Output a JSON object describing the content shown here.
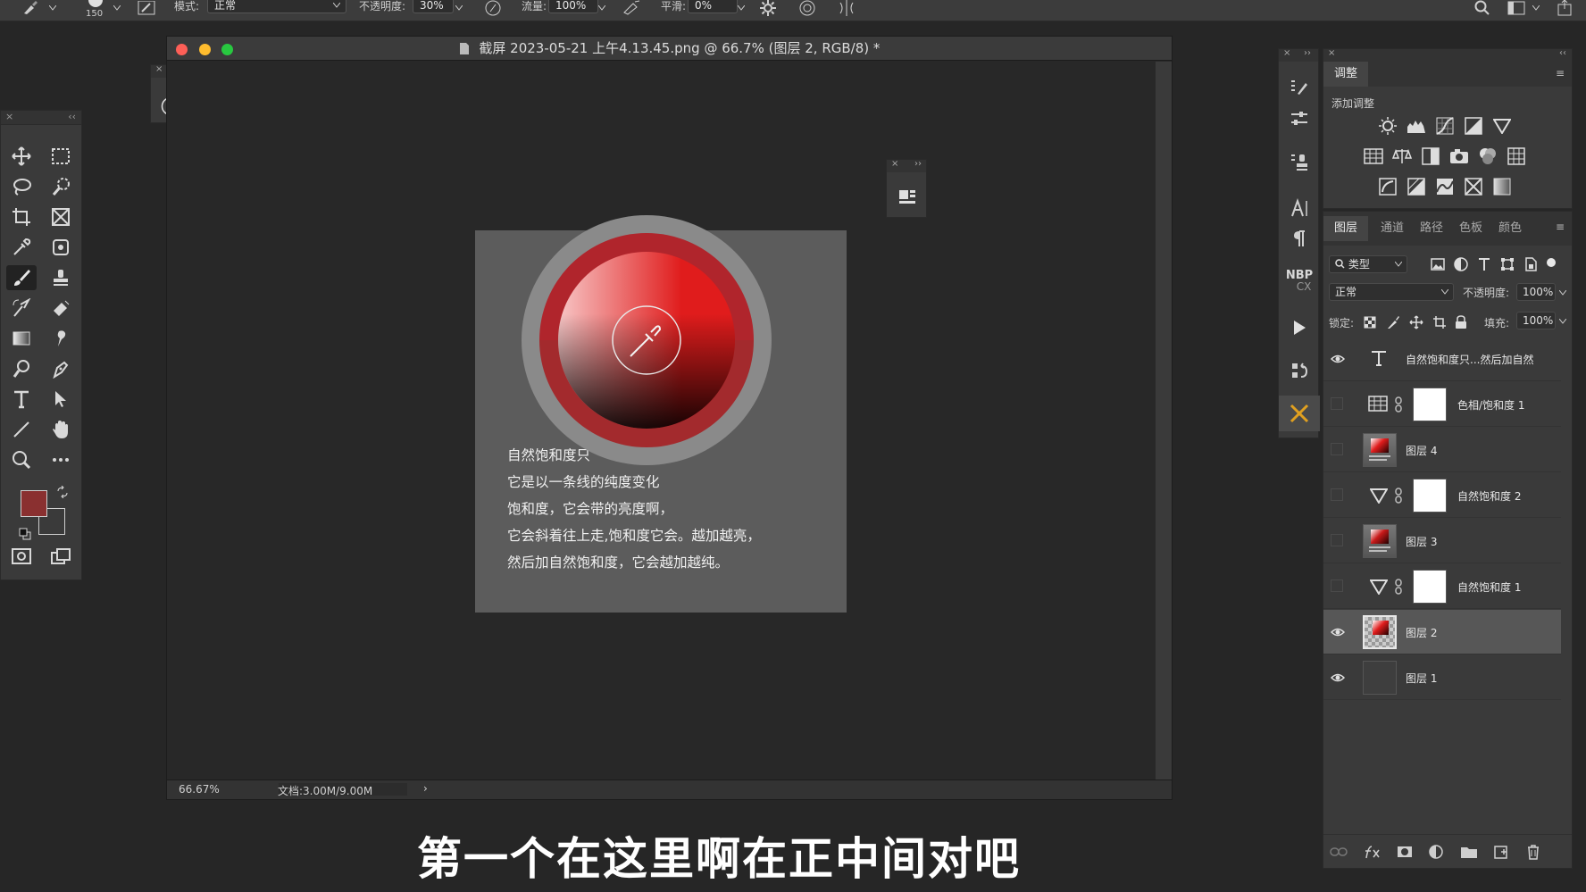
{
  "options_bar": {
    "brush_size": "150",
    "mode_label": "模式:",
    "mode_value": "正常",
    "opacity_label": "不透明度:",
    "opacity_value": "30%",
    "flow_label": "流量:",
    "flow_value": "100%",
    "smoothing_label": "平滑:",
    "smoothing_value": "0%"
  },
  "document": {
    "title": "截屏 2023-05-21 上午4.13.45.png @ 66.7% (图层 2, RGB/8) *",
    "zoom": "66.67%",
    "doc_size": "文档:3.00M/9.00M",
    "status_arrow": "›"
  },
  "canvas_text": [
    "自然饱和度只",
    "它是以一条线的纯度变化",
    "饱和度，它会带的亮度啊，",
    "它会斜着往上走,饱和度它会。越加越亮，",
    "然后加自然饱和度，它会越加越纯。"
  ],
  "colors": {
    "foreground": "#8a3030",
    "background": "#3a3a3a",
    "accent": "#d03030"
  },
  "adjustments": {
    "tab": "调整",
    "add_label": "添加调整"
  },
  "layers_panel": {
    "tabs": [
      "图层",
      "通道",
      "路径",
      "色板",
      "颜色"
    ],
    "filter_label": "类型",
    "blend_mode": "正常",
    "opacity_label": "不透明度:",
    "opacity_value": "100%",
    "lock_label": "锁定:",
    "fill_label": "填充:",
    "fill_value": "100%",
    "layers": [
      {
        "name": "自然饱和度只...然后加自然",
        "kind": "text",
        "visible": true
      },
      {
        "name": "色相/饱和度 1",
        "kind": "huesat",
        "visible": false
      },
      {
        "name": "图层 4",
        "kind": "image",
        "visible": false
      },
      {
        "name": "自然饱和度 2",
        "kind": "vibrance",
        "visible": false
      },
      {
        "name": "图层 3",
        "kind": "image",
        "visible": false
      },
      {
        "name": "自然饱和度 1",
        "kind": "vibrance",
        "visible": false
      },
      {
        "name": "图层 2",
        "kind": "image",
        "visible": true,
        "selected": true
      },
      {
        "name": "图层 1",
        "kind": "fill",
        "visible": true
      }
    ]
  },
  "strip": {
    "plugin_label_1": "NBP",
    "plugin_label_2": "CX"
  },
  "subtitle": "第一个在这里啊在正中间对吧"
}
